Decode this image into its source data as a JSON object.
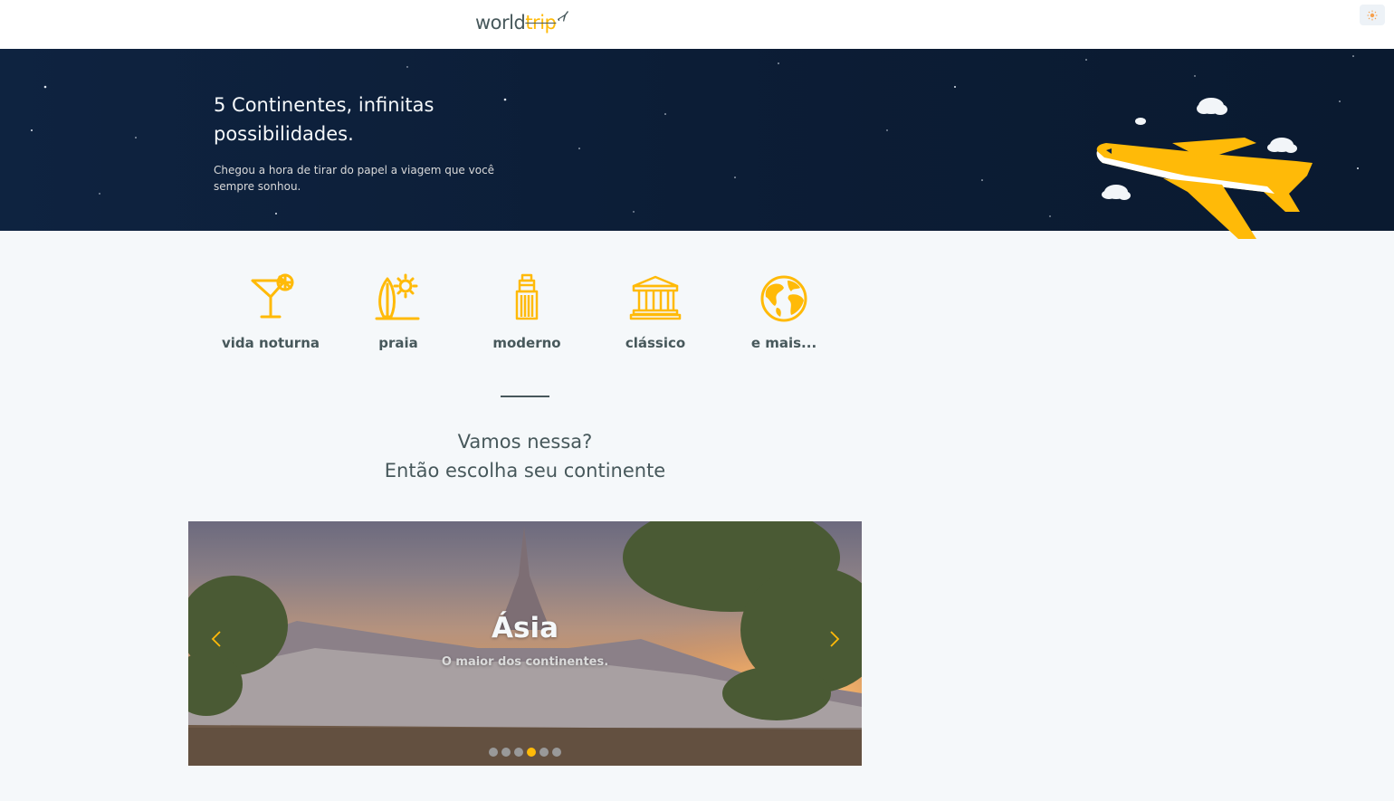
{
  "header": {
    "logo_world": "world",
    "logo_trip": "trip",
    "theme_toggle_icon": "sun-icon"
  },
  "banner": {
    "title": "5 Continentes, infinitas possibilidades.",
    "subtitle": "Chegou a hora de tirar do papel a viagem que você sempre sonhou."
  },
  "travel_types": [
    {
      "label": "vida noturna",
      "icon": "cocktail-icon"
    },
    {
      "label": "praia",
      "icon": "surfboard-sun-icon"
    },
    {
      "label": "moderno",
      "icon": "building-icon"
    },
    {
      "label": "clássico",
      "icon": "museum-icon"
    },
    {
      "label": "e mais...",
      "icon": "globe-icon"
    }
  ],
  "cta": {
    "line1": "Vamos nessa?",
    "line2": "Então escolha seu continente"
  },
  "carousel": {
    "title": "Ásia",
    "subtitle": "O maior dos continentes.",
    "slide_count": 6,
    "active_index": 3
  },
  "colors": {
    "accent": "#ffba08",
    "text": "#47585b",
    "banner_bg": "#0c1d36",
    "page_bg": "#f5f8fa"
  }
}
